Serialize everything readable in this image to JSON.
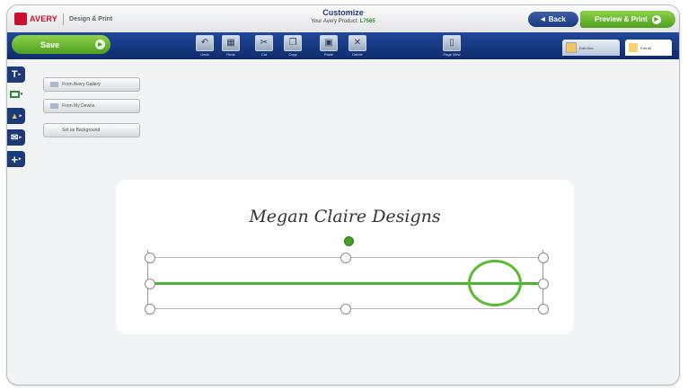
{
  "header": {
    "brand": "AVERY",
    "brand_sub": "Design & Print",
    "page_title": "Customize",
    "product_line_prefix": "Your Avery Product:",
    "product_sku": "L7565",
    "back_label": "Back",
    "preview_label": "Preview & Print"
  },
  "toolbar": {
    "save_label": "Save",
    "tools": [
      {
        "label": "Undo",
        "icon": "undo-icon",
        "glyph": "↶"
      },
      {
        "label": "Redo",
        "icon": "redo-icon",
        "glyph": "▦"
      },
      {
        "label": "Cut",
        "icon": "cut-icon",
        "glyph": "✂"
      },
      {
        "label": "Copy",
        "icon": "copy-icon",
        "glyph": "❐"
      },
      {
        "label": "Paste",
        "icon": "paste-icon",
        "glyph": "▣"
      },
      {
        "label": "Delete",
        "icon": "delete-icon",
        "glyph": "✕"
      },
      {
        "label": "Page View",
        "icon": "page-view-icon",
        "glyph": "▯"
      }
    ],
    "view_tabs": [
      "Edit One",
      "Edit All"
    ]
  },
  "sidebar": {
    "icons": [
      "text-icon",
      "image-icon",
      "shapes-icon",
      "mail-merge-icon",
      "add-more-icon"
    ],
    "image_buttons": [
      "From Avery Gallery",
      "From My Device",
      "Set as Background"
    ]
  },
  "canvas": {
    "design_title": "Megan Claire Designs"
  },
  "colors": {
    "toolbar_blue": "#1b3a7c",
    "action_green": "#4c9f1e",
    "brand_red": "#c8102e",
    "selection_line_green": "#4cb52f"
  }
}
